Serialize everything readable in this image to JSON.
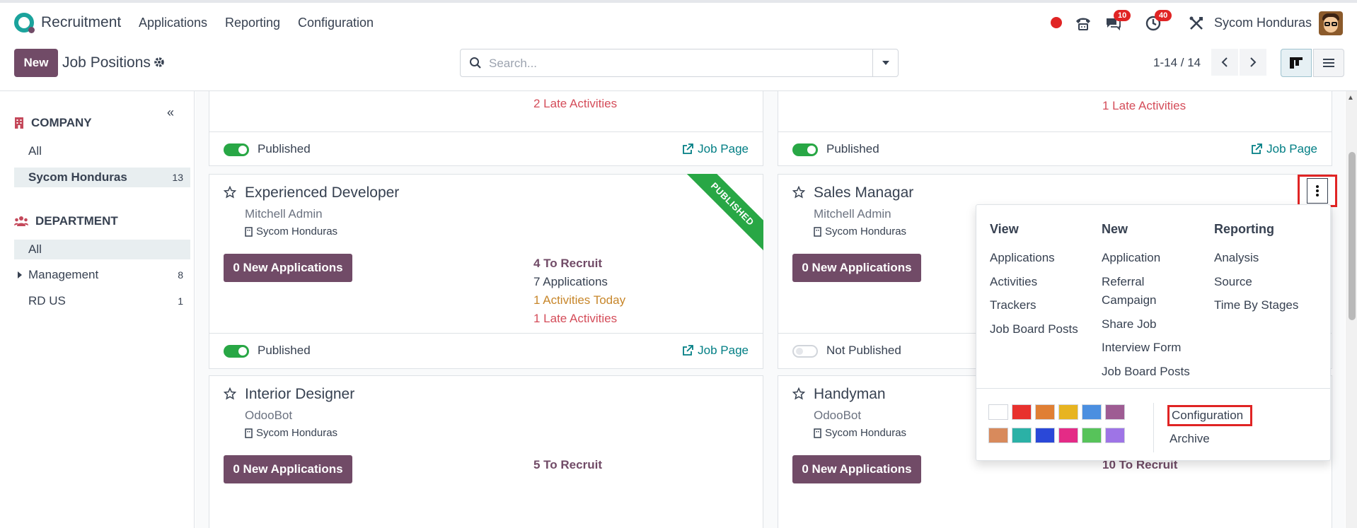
{
  "navbar": {
    "app_name": "Recruitment",
    "menus": [
      "Applications",
      "Reporting",
      "Configuration"
    ],
    "messages_badge": "10",
    "activities_badge": "40",
    "company": "Sycom Honduras"
  },
  "control": {
    "new_label": "New",
    "title": "Job Positions",
    "search_placeholder": "Search...",
    "pager": "1-14 / 14"
  },
  "sidebar": {
    "company_head": "COMPANY",
    "company_items": [
      {
        "label": "All",
        "count": ""
      },
      {
        "label": "Sycom Honduras",
        "count": "13"
      }
    ],
    "department_head": "DEPARTMENT",
    "department_items": [
      {
        "label": "All",
        "count": ""
      },
      {
        "label": "Management",
        "count": "8"
      },
      {
        "label": "RD US",
        "count": "1"
      }
    ]
  },
  "cards": {
    "top_left": {
      "late": "2 Late Activities",
      "published": "Published",
      "job_page": "Job Page"
    },
    "top_right": {
      "late": "1 Late Activities",
      "published": "Published",
      "job_page": "Job Page"
    },
    "exp_dev": {
      "title": "Experienced Developer",
      "user": "Mitchell Admin",
      "company": "Sycom Honduras",
      "apps_btn": "0 New Applications",
      "ribbon": "PUBLISHED",
      "to_recruit": "4 To Recruit",
      "applications": "7 Applications",
      "today": "1 Activities Today",
      "late": "1 Late Activities",
      "published": "Published",
      "job_page": "Job Page"
    },
    "sales": {
      "title": "Sales Managar",
      "user": "Mitchell Admin",
      "company": "Sycom Honduras",
      "apps_btn": "0 New Applications",
      "published": "Not Published"
    },
    "interior": {
      "title": "Interior Designer",
      "user": "OdooBot",
      "company": "Sycom Honduras",
      "apps_btn": "0 New Applications",
      "to_recruit": "5 To Recruit"
    },
    "handyman": {
      "title": "Handyman",
      "user": "OdooBot",
      "company": "Sycom Honduras",
      "apps_btn": "0 New Applications",
      "to_recruit": "10 To Recruit"
    }
  },
  "dropdown": {
    "view_head": "View",
    "view_items": [
      "Applications",
      "Activities",
      "Trackers",
      "Job Board Posts"
    ],
    "new_head": "New",
    "new_items": [
      "Application",
      "Referral",
      "Campaign",
      "Share Job",
      "Interview Form",
      "Job Board Posts"
    ],
    "reporting_head": "Reporting",
    "reporting_items": [
      "Analysis",
      "Source",
      "Time By Stages"
    ],
    "configuration": "Configuration",
    "archive": "Archive",
    "colors_row1": [
      "#ffffff",
      "#e8312e",
      "#e07f34",
      "#e7b421",
      "#4b8fe0",
      "#9e5c93"
    ],
    "colors_row2": [
      "#d88a5c",
      "#2bb1a6",
      "#2a48d8",
      "#e42b86",
      "#57c35a",
      "#9e74e6"
    ]
  },
  "colors": {
    "brand": "#714b67",
    "link": "#017e84",
    "success": "#28a745",
    "danger": "#e02424"
  }
}
